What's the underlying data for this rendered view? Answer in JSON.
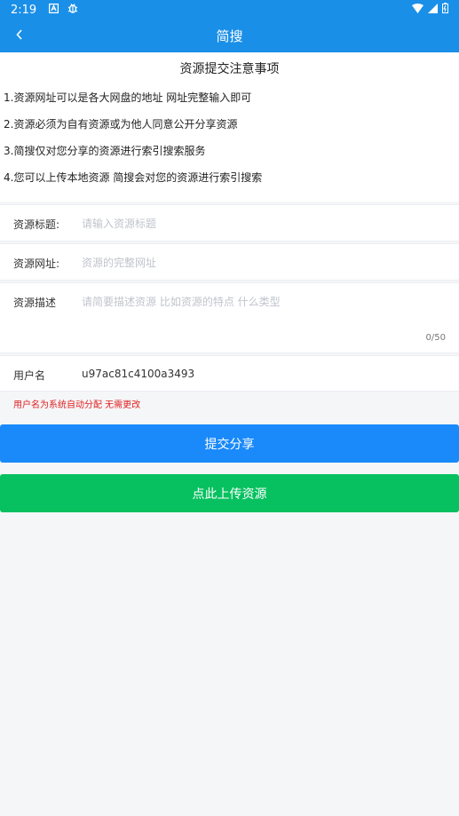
{
  "status_bar": {
    "time": "2:19",
    "icons": [
      "notification-a-icon",
      "bug-icon",
      "wifi-icon",
      "signal-icon",
      "battery-icon"
    ]
  },
  "app_bar": {
    "title": "简搜",
    "back_icon": "chevron-left-icon"
  },
  "notice": {
    "title": "资源提交注意事项",
    "items": [
      "1.资源网址可以是各大网盘的地址 网址完整输入即可",
      "2.资源必须为自有资源或为他人同意公开分享资源",
      "3.简搜仅对您分享的资源进行索引搜索服务",
      "4.您可以上传本地资源 简搜会对您的资源进行索引搜索"
    ]
  },
  "form": {
    "title_label": "资源标题:",
    "title_placeholder": "请输入资源标题",
    "url_label": "资源网址:",
    "url_placeholder": "资源的完整网址",
    "desc_label": "资源描述",
    "desc_placeholder": "请简要描述资源 比如资源的特点 什么类型",
    "desc_counter": "0/50",
    "username_label": "用户名",
    "username_value": "u97ac81c4100a3493",
    "username_hint": "用户名为系统自动分配 无需更改"
  },
  "buttons": {
    "submit": "提交分享",
    "upload": "点此上传资源"
  },
  "colors": {
    "primary": "#1a8fe8",
    "submit": "#1a8afa",
    "upload": "#07c160",
    "hint": "#e02020"
  }
}
